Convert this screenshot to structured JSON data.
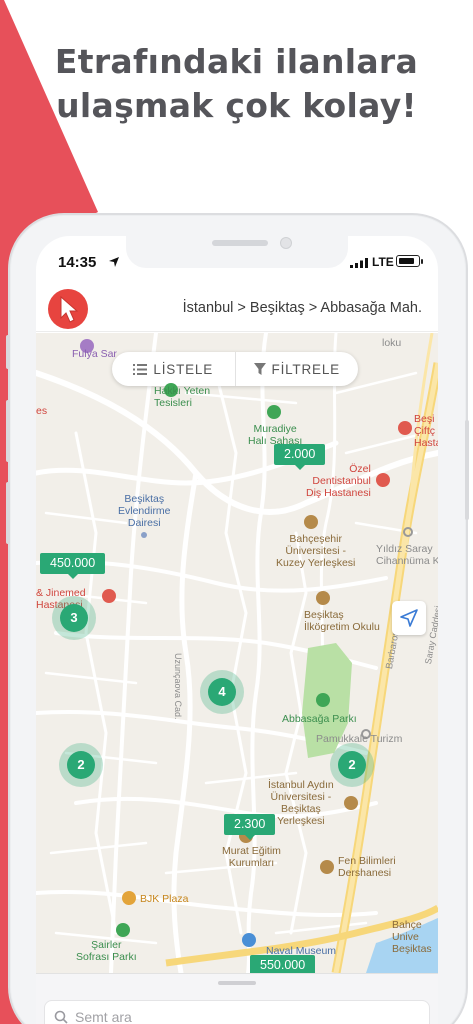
{
  "headline": {
    "line1": "Etrafındaki ilanlara",
    "line2": "ulaşmak çok kolay!"
  },
  "colors": {
    "accent_red": "#e7443f",
    "listing_green": "#2aa875",
    "map_bg": "#f2efe9"
  },
  "status_bar": {
    "time": "14:35",
    "network": "LTE",
    "battery_level": 0.85
  },
  "nav": {
    "logo_icon": "cursor-arrow-icon",
    "breadcrumb": "İstanbul > Beşiktaş > Abbasağa Mah."
  },
  "map_controls": {
    "list_label": "LİSTELE",
    "filter_label": "FİLTRELE",
    "list_icon": "list-icon",
    "filter_icon": "funnel-icon",
    "locate_icon": "location-arrow-icon"
  },
  "map": {
    "pois": {
      "fulya": "Fulya Sar",
      "hakki_yeten_1": "Hakkı Yeten",
      "hakki_yeten_2": "Tesisleri",
      "muradiye_1": "Muradiye",
      "muradiye_2": "Halı Sahası",
      "besiktas_sag_1": "Beşi",
      "besiktas_sag_2": "Çiftç",
      "besiktas_sag_3": "Hasta",
      "ozel_1": "Özel",
      "ozel_2": "Dentistanbul",
      "ozel_3": "Diş Hastanesi",
      "evlendirme_1": "Beşiktaş",
      "evlendirme_2": "Evlendirme",
      "evlendirme_3": "Dairesi",
      "bahcesehir_1": "Bahçeşehir",
      "bahcesehir_2": "Üniversitesi -",
      "bahcesehir_3": "Kuzey Yerleşkesi",
      "yildiz_1": "Yıldız Saray",
      "yildiz_2": "Cihannüma Ko",
      "jinemed_1": "& Jinemed",
      "jinemed_2": "Hastanesi",
      "ilkogretim_1": "Beşiktaş",
      "ilkogretim_2": "İlkögretim Okulu",
      "uzuncaova": "Uzunçaova Cad.",
      "barbaros": "Barbaros",
      "saray": "Saray Caddesi",
      "abbasaga": "Abbasağa Parkı",
      "pamukkale": "Pamukkale Turizm",
      "aydin_1": "İstanbul Aydın",
      "aydin_2": "Üniversitesi -",
      "aydin_3": "Beşiktaş",
      "aydin_4": "Yerleşkesi",
      "murat_1": "Murat Eğitim",
      "murat_2": "Kurumları",
      "fen_1": "Fen Bilimleri",
      "fen_2": "Dershanesi",
      "bjk": "BJK Plaza",
      "sairler_1": "Şairler",
      "sairler_2": "Sofrası Parkı",
      "naval": "Naval Museum",
      "bahce_1": "Bahçe",
      "bahce_2": "Unive",
      "bahce_3": "Beşiktas",
      "es": "es",
      "ioku": "loku"
    },
    "price_pins": [
      "2.000",
      "450.000",
      "2.300",
      "550.000"
    ],
    "clusters": [
      "3",
      "4",
      "2",
      "2"
    ]
  },
  "search": {
    "placeholder": "Semt ara"
  }
}
